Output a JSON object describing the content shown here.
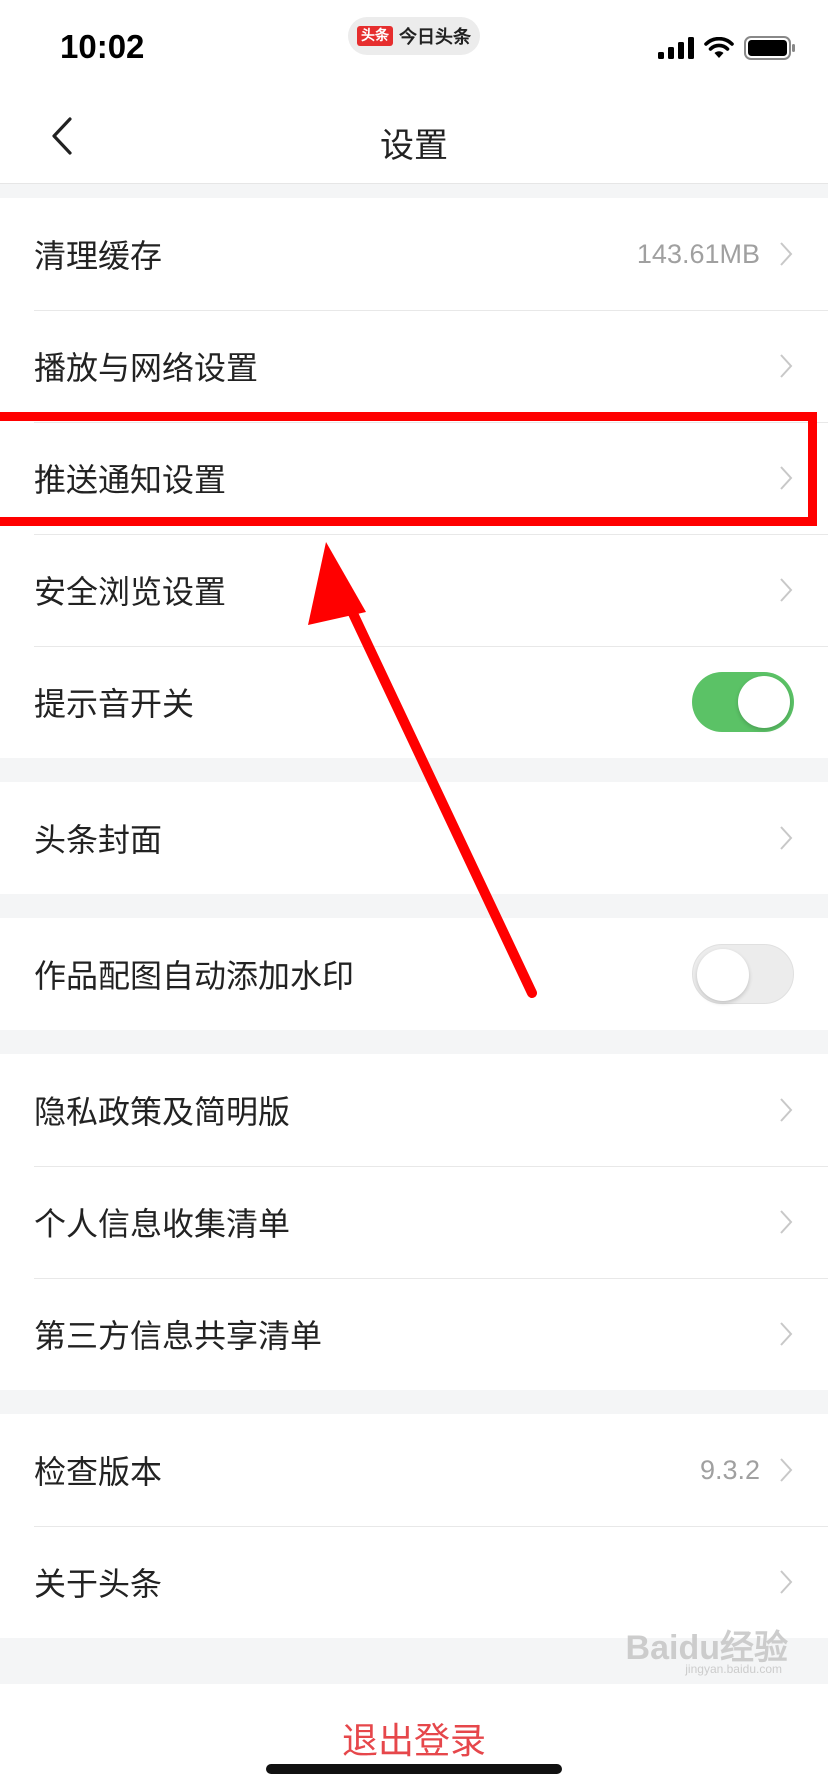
{
  "status": {
    "time": "10:02",
    "app_badge": "头条",
    "app_name": "今日头条"
  },
  "nav": {
    "title": "设置"
  },
  "groups": [
    {
      "items": [
        {
          "label": "清理缓存",
          "value": "143.61MB",
          "type": "link"
        },
        {
          "label": "播放与网络设置",
          "type": "link"
        },
        {
          "label": "推送通知设置",
          "type": "link",
          "highlighted": true
        },
        {
          "label": "安全浏览设置",
          "type": "link"
        },
        {
          "label": "提示音开关",
          "type": "toggle",
          "on": true
        }
      ]
    },
    {
      "items": [
        {
          "label": "头条封面",
          "type": "link"
        }
      ]
    },
    {
      "items": [
        {
          "label": "作品配图自动添加水印",
          "type": "toggle",
          "on": false
        }
      ]
    },
    {
      "items": [
        {
          "label": "隐私政策及简明版",
          "type": "link"
        },
        {
          "label": "个人信息收集清单",
          "type": "link"
        },
        {
          "label": "第三方信息共享清单",
          "type": "link"
        }
      ]
    },
    {
      "items": [
        {
          "label": "检查版本",
          "value": "9.3.2",
          "type": "link"
        },
        {
          "label": "关于头条",
          "type": "link"
        }
      ]
    }
  ],
  "logout": {
    "label": "退出登录"
  },
  "watermark": {
    "brand": "Baidu经验",
    "url": "jingyan.baidu.com"
  },
  "colors": {
    "toggle_on": "#5bc266",
    "logout_text": "#e6474b",
    "annotation": "#ff0000"
  }
}
